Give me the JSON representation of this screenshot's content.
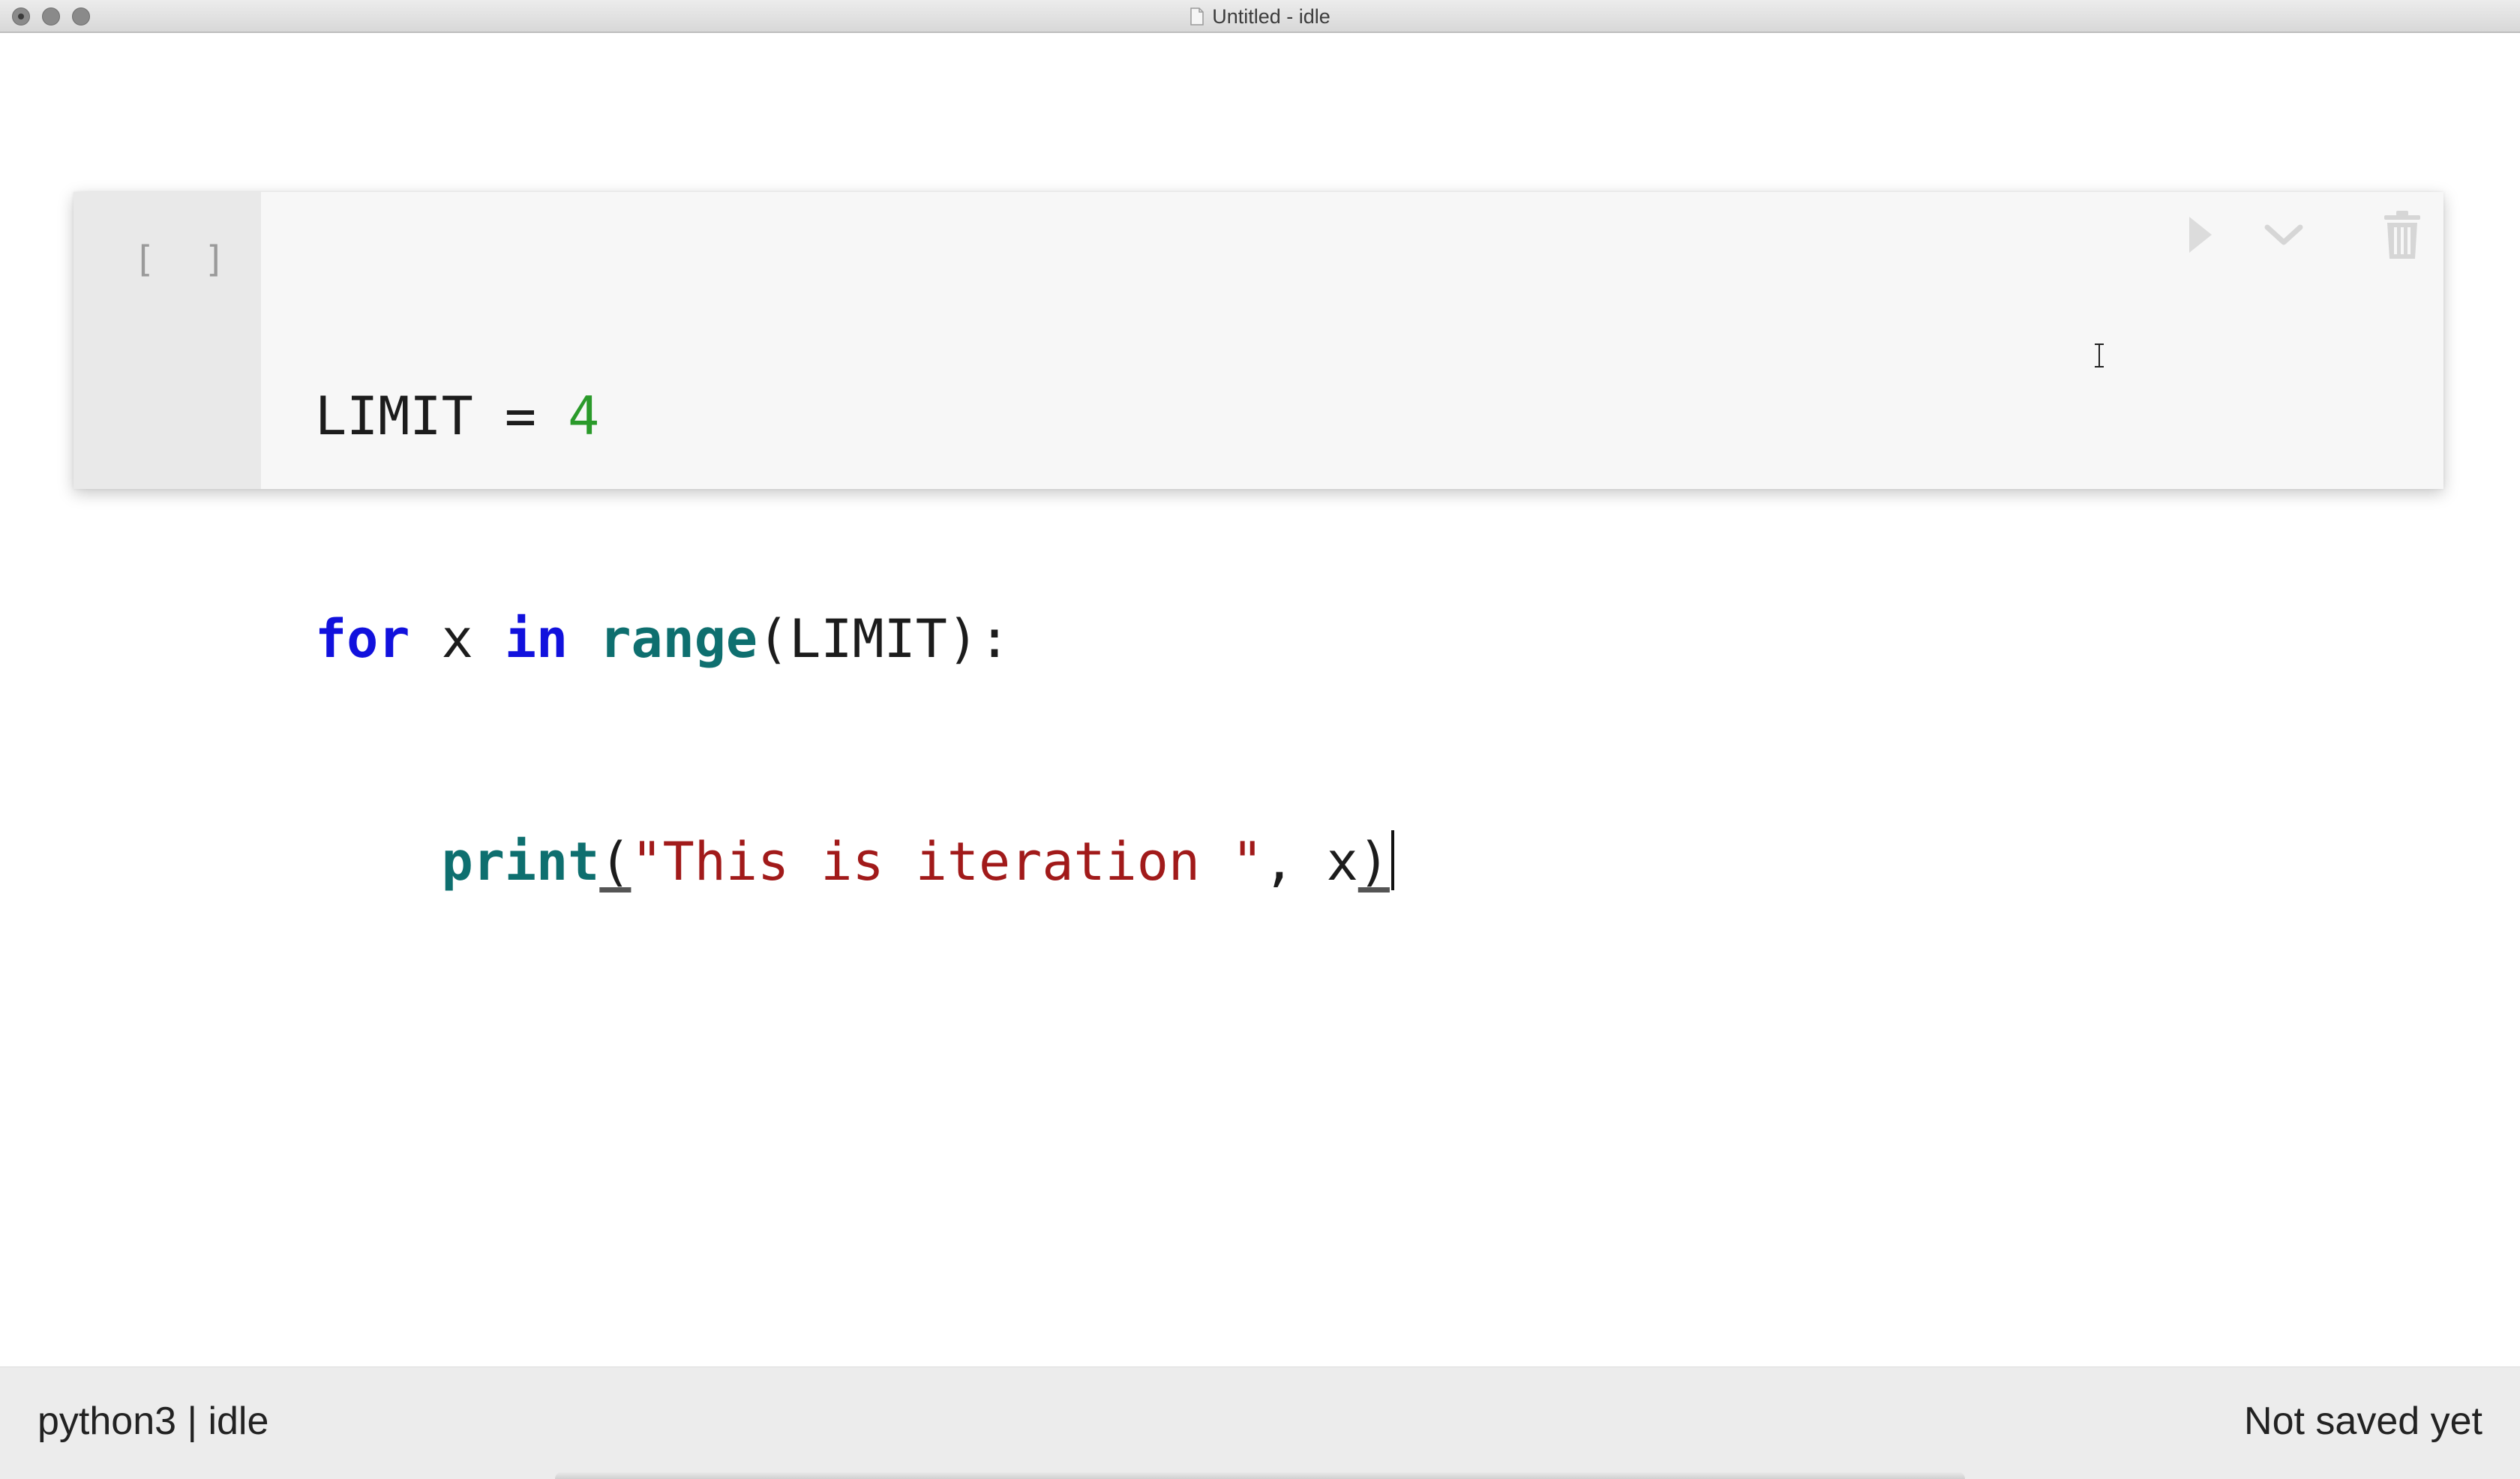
{
  "window": {
    "title": "Untitled - idle"
  },
  "cell": {
    "prompt": "[ ]",
    "code": {
      "line1": {
        "name": "LIMIT",
        "op": " = ",
        "value": "4"
      },
      "line2": {
        "kw_for": "for",
        "var": " x ",
        "kw_in": "in",
        "space": " ",
        "func": "range",
        "args": "(LIMIT):"
      },
      "line3": {
        "indent": "    ",
        "func": "print",
        "open": "(",
        "string": "\"This is iteration \"",
        "sep": ", x",
        "close": ")"
      }
    },
    "toolbar": {
      "run_icon": "play-icon",
      "more_icon": "chevron-down-icon",
      "delete_icon": "trash-icon"
    }
  },
  "statusbar": {
    "kernel": "python3 | idle",
    "save_state": "Not saved yet"
  },
  "colors": {
    "keyword": "#1111dd",
    "builtin": "#0e6f6f",
    "number": "#2a9a2a",
    "string": "#a11a1a"
  }
}
